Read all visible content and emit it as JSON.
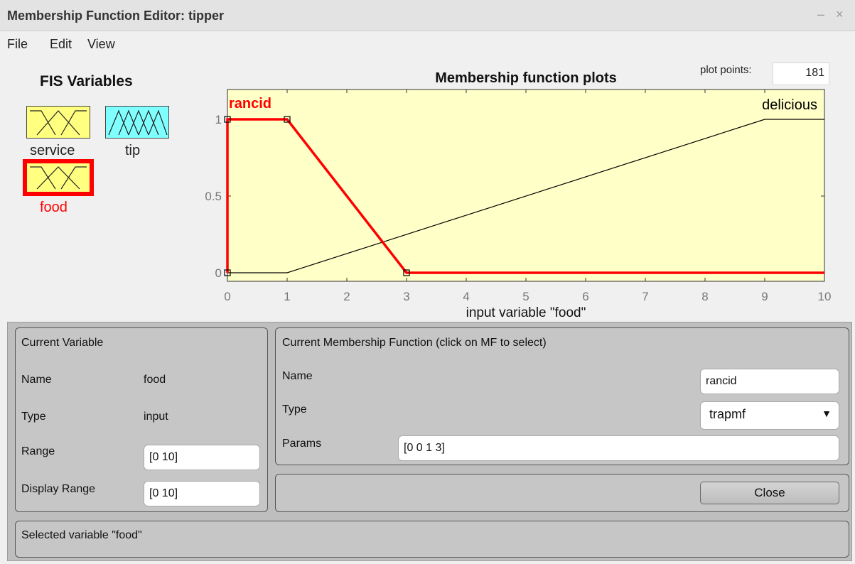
{
  "window": {
    "title": "Membership Function Editor: tipper",
    "minimize": "–",
    "close": "×"
  },
  "menu": [
    "File",
    "Edit",
    "View"
  ],
  "fis": {
    "title": "FIS Variables",
    "variables": [
      {
        "name": "service",
        "kind": "input",
        "color": "#ffff80"
      },
      {
        "name": "tip",
        "kind": "output",
        "color": "#80ffff"
      },
      {
        "name": "food",
        "kind": "input",
        "color": "#ffff80",
        "selected": true,
        "selected_color": "#ff0000"
      }
    ]
  },
  "plot_points": {
    "label": "plot points:",
    "value": "181"
  },
  "chart_data": {
    "type": "line",
    "title": "Membership function plots",
    "xlabel": "input variable \"food\"",
    "ylabel": "",
    "xlim": [
      0,
      10
    ],
    "ylim": [
      0,
      1
    ],
    "xticks": [
      "0",
      "1",
      "2",
      "3",
      "4",
      "5",
      "6",
      "7",
      "8",
      "9",
      "10"
    ],
    "yticks": [
      "0",
      "0.5",
      "1"
    ],
    "background": "#ffffc8",
    "series": [
      {
        "name": "rancid",
        "color": "#ff0000",
        "selected": true,
        "x": [
          0,
          0,
          1,
          3,
          10
        ],
        "y": [
          0,
          1,
          1,
          0,
          0
        ]
      },
      {
        "name": "delicious",
        "color": "#000000",
        "selected": false,
        "x": [
          0,
          1,
          9,
          10
        ],
        "y": [
          0,
          0,
          1,
          1
        ]
      }
    ],
    "selected_handles": [
      [
        0,
        1
      ],
      [
        1,
        1
      ],
      [
        3,
        0
      ],
      [
        0,
        0
      ]
    ]
  },
  "current_variable": {
    "title": "Current Variable",
    "name_label": "Name",
    "name_value": "food",
    "type_label": "Type",
    "type_value": "input",
    "range_label": "Range",
    "range_value": "[0 10]",
    "display_range_label": "Display Range",
    "display_range_value": "[0 10]"
  },
  "current_mf": {
    "title": "Current Membership Function (click on MF to select)",
    "name_label": "Name",
    "name_value": "rancid",
    "type_label": "Type",
    "type_value": "trapmf",
    "params_label": "Params",
    "params_value": "[0 0 1 3]"
  },
  "close_button": "Close",
  "status": "Selected variable \"food\""
}
